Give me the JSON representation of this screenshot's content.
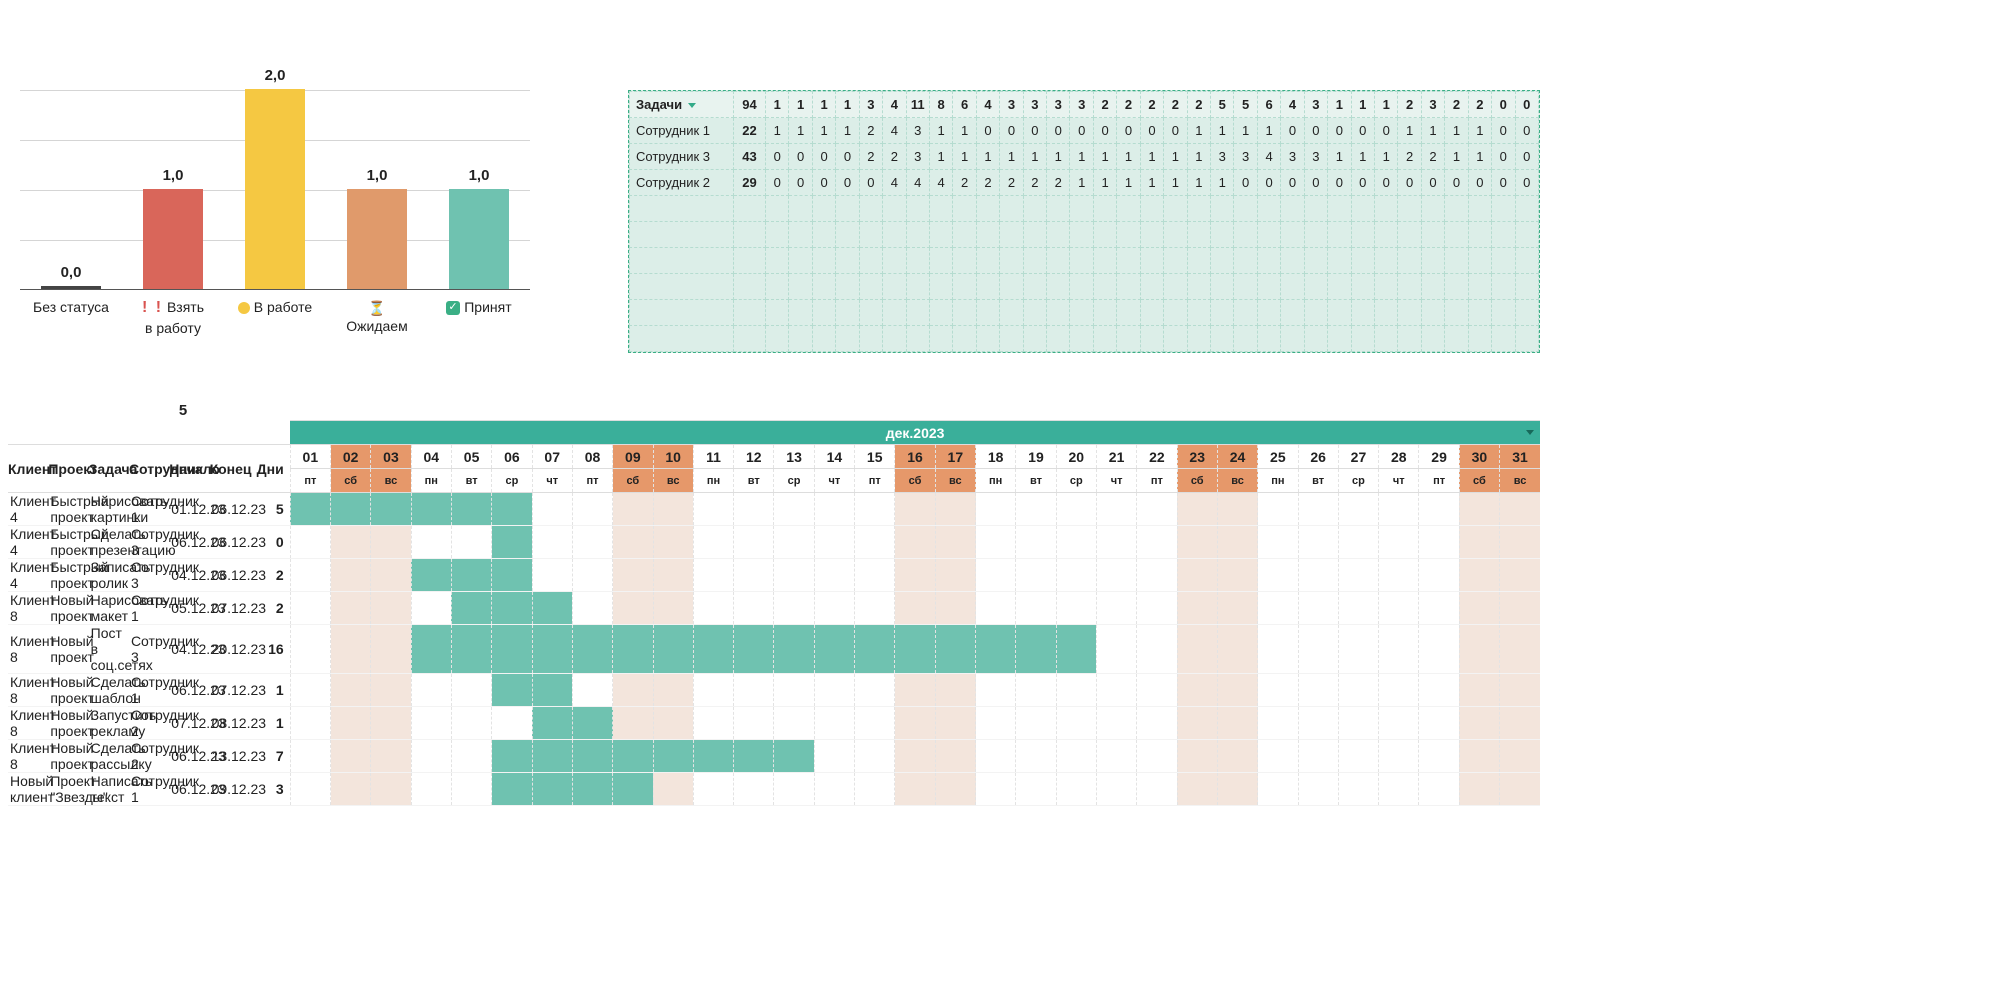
{
  "chart_data": {
    "type": "bar",
    "categories": [
      "Без статуса",
      "❗❗ Взять в работу",
      "🟡 В работе",
      "⏳ Ожидаем",
      "✅ Принят"
    ],
    "values": [
      0.0,
      1.0,
      2.0,
      1.0,
      1.0
    ],
    "value_labels": [
      "0,0",
      "1,0",
      "2,0",
      "1,0",
      "1,0"
    ],
    "colors": [
      "#444",
      "#d9665a",
      "#f5c842",
      "#e09a6b",
      "#6fc2b0"
    ],
    "ylim": [
      0,
      2
    ],
    "title": "",
    "xlabel": "",
    "ylabel": ""
  },
  "axis_labels": {
    "a0": "Без статуса",
    "a1_top": "Взять",
    "a1_bot": "в работу",
    "a2": "В работе",
    "a3": "Ожидаем",
    "a4": "Принят",
    "hourglass": "⏳"
  },
  "emp": {
    "header_label": "Задачи",
    "total": "94",
    "day_totals": [
      "1",
      "1",
      "1",
      "1",
      "3",
      "4",
      "11",
      "8",
      "6",
      "4",
      "3",
      "3",
      "3",
      "3",
      "2",
      "2",
      "2",
      "2",
      "2",
      "5",
      "5",
      "6",
      "4",
      "3",
      "1",
      "1",
      "1",
      "2",
      "3",
      "2",
      "2",
      "0",
      "0"
    ],
    "rows": [
      {
        "name": "Сотрудник 1",
        "total": "22",
        "vals": [
          "1",
          "1",
          "1",
          "1",
          "2",
          "4",
          "3",
          "1",
          "1",
          "0",
          "0",
          "0",
          "0",
          "0",
          "0",
          "0",
          "0",
          "0",
          "1",
          "1",
          "1",
          "1",
          "0",
          "0",
          "0",
          "0",
          "0",
          "1",
          "1",
          "1",
          "1",
          "0",
          "0"
        ]
      },
      {
        "name": "Сотрудник 3",
        "total": "43",
        "vals": [
          "0",
          "0",
          "0",
          "0",
          "2",
          "2",
          "3",
          "1",
          "1",
          "1",
          "1",
          "1",
          "1",
          "1",
          "1",
          "1",
          "1",
          "1",
          "1",
          "3",
          "3",
          "4",
          "3",
          "3",
          "1",
          "1",
          "1",
          "2",
          "2",
          "1",
          "1",
          "0",
          "0"
        ]
      },
      {
        "name": "Сотрудник 2",
        "total": "29",
        "vals": [
          "0",
          "0",
          "0",
          "0",
          "0",
          "4",
          "4",
          "4",
          "2",
          "2",
          "2",
          "2",
          "2",
          "1",
          "1",
          "1",
          "1",
          "1",
          "1",
          "1",
          "0",
          "0",
          "0",
          "0",
          "0",
          "0",
          "0",
          "0",
          "0",
          "0",
          "0",
          "0",
          "0"
        ]
      }
    ]
  },
  "gantt": {
    "top_number": "5",
    "month_label": "дек.2023",
    "headers": {
      "client": "Клиент",
      "project": "Проект",
      "task": "Задача",
      "emp": "Сотрудник",
      "start": "Начало",
      "end": "Конец",
      "days": "Дни"
    },
    "days": [
      "01",
      "02",
      "03",
      "04",
      "05",
      "06",
      "07",
      "08",
      "09",
      "10",
      "11",
      "12",
      "13",
      "14",
      "15",
      "16",
      "17",
      "18",
      "19",
      "20",
      "21",
      "22",
      "23",
      "24",
      "25",
      "26",
      "27",
      "28",
      "29",
      "30",
      "31"
    ],
    "dows": [
      "пт",
      "сб",
      "вс",
      "пн",
      "вт",
      "ср",
      "чт",
      "пт",
      "сб",
      "вс",
      "пн",
      "вт",
      "ср",
      "чт",
      "пт",
      "сб",
      "вс",
      "пн",
      "вт",
      "ср",
      "чт",
      "пт",
      "сб",
      "вс",
      "пн",
      "вт",
      "ср",
      "чт",
      "пт",
      "сб",
      "вс"
    ],
    "weekend_idx": [
      1,
      2,
      8,
      9,
      15,
      16,
      22,
      23,
      29,
      30
    ],
    "rows": [
      {
        "client": "Клиент 4",
        "project": "Быстрый проект",
        "task": "Нарисовать картинки",
        "emp": "Сотрудник 1",
        "start": "01.12.23",
        "end": "06.12.23",
        "days": "5",
        "bar_from": 1,
        "bar_to": 6
      },
      {
        "client": "Клиент 4",
        "project": "Быстрый проект",
        "task": "Сделать презентацию",
        "emp": "Сотрудник 3",
        "start": "06.12.23",
        "end": "06.12.23",
        "days": "0",
        "bar_from": 6,
        "bar_to": 6
      },
      {
        "client": "Клиент 4",
        "project": "Быстрый проект",
        "task": "Записать ролик",
        "emp": "Сотрудник 3",
        "start": "04.12.23",
        "end": "06.12.23",
        "days": "2",
        "bar_from": 4,
        "bar_to": 6
      },
      {
        "client": "Клиент 8",
        "project": "Новый проект",
        "task": "Нарисовать макет",
        "emp": "Сотрудник 1",
        "start": "05.12.23",
        "end": "07.12.23",
        "days": "2",
        "bar_from": 5,
        "bar_to": 7
      },
      {
        "client": "Клиент 8",
        "project": "Новый проект",
        "task": "Пост в соц.сетях",
        "emp": "Сотрудник 3",
        "start": "04.12.23",
        "end": "20.12.23",
        "days": "16",
        "bar_from": 4,
        "bar_to": 20
      },
      {
        "client": "Клиент 8",
        "project": "Новый проект",
        "task": "Сделать шаблон",
        "emp": "Сотрудник 1",
        "start": "06.12.23",
        "end": "07.12.23",
        "days": "1",
        "bar_from": 6,
        "bar_to": 7
      },
      {
        "client": "Клиент 8",
        "project": "Новый проект",
        "task": "Запустить рекламу",
        "emp": "Сотрудник 2",
        "start": "07.12.23",
        "end": "08.12.23",
        "days": "1",
        "bar_from": 7,
        "bar_to": 8
      },
      {
        "client": "Клиент 8",
        "project": "Новый проект",
        "task": "Сделать рассылку",
        "emp": "Сотрудник 2",
        "start": "06.12.23",
        "end": "13.12.23",
        "days": "7",
        "bar_from": 6,
        "bar_to": 13
      },
      {
        "client": "Новый клиент",
        "project": "Проект \"Звезды\"",
        "task": "Написать текст",
        "emp": "Сотрудник 1",
        "start": "06.12.23",
        "end": "09.12.23",
        "days": "3",
        "bar_from": 6,
        "bar_to": 9
      }
    ]
  }
}
